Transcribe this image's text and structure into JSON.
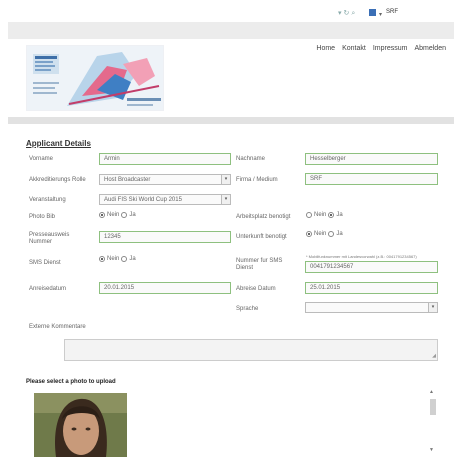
{
  "browser": {
    "search_value": "SRF"
  },
  "nav": {
    "items": [
      "Home",
      "Kontakt",
      "Impressum",
      "Abmelden"
    ]
  },
  "form": {
    "title": "Applicant Details",
    "vorname": {
      "label": "Vorname",
      "value": "Armin"
    },
    "nachname": {
      "label": "Nachname",
      "value": "Hesselberger"
    },
    "akk_rolle": {
      "label": "Akkreditierungs Rolle",
      "value": "Host Broadcaster"
    },
    "firma": {
      "label": "Firma / Medium",
      "value": "SRF"
    },
    "veranstaltung": {
      "label": "Veranstaltung",
      "value": "Audi FIS Ski World Cup 2015"
    },
    "photo_bib": {
      "label": "Photo Bib",
      "options": [
        "Nein",
        "Ja"
      ],
      "selected": "Nein"
    },
    "arbeitsplatz": {
      "label": "Arbeitsplatz benotigt",
      "options": [
        "Nein",
        "Ja"
      ],
      "selected": "Ja"
    },
    "presseausweis": {
      "label": "Presseausweis Nummer",
      "value": "12345"
    },
    "unterkunft": {
      "label": "Unterkunft benotigt",
      "options": [
        "Nein",
        "Ja"
      ],
      "selected": "Nein"
    },
    "sms": {
      "label": "SMS Dienst",
      "options": [
        "Nein",
        "Ja"
      ],
      "selected": "Nein"
    },
    "sms_nummer": {
      "label": "Nummer fur SMS Dienst",
      "hint": "* Mobilfunknummer mit Landesvorwahl (z.B.: 0041791234567)",
      "value": "0041791234567"
    },
    "anreise": {
      "label": "Anreisedatum",
      "value": "20.01.2015"
    },
    "abreise": {
      "label": "Abreise Datum",
      "value": "25.01.2015"
    },
    "sprache": {
      "label": "Sprache",
      "value": ""
    },
    "kommentare": {
      "label": "Externe Kommentare"
    }
  },
  "photo": {
    "title": "Please select a photo to upload"
  },
  "colors": {
    "valid_border": "#8ec07f",
    "link_blue": "#3b6fb6"
  }
}
